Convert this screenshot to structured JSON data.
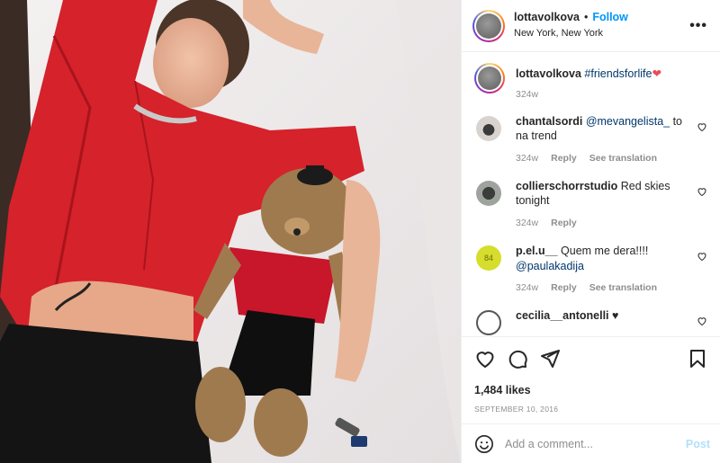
{
  "post": {
    "image_alt": "photo",
    "author": {
      "username": "lottavolkova",
      "separator": "•",
      "follow_label": "Follow",
      "location": "New York, New York",
      "more_icon": "more-horizontal-icon"
    },
    "caption": {
      "username": "lottavolkova",
      "hashtag": "#friendsforlife",
      "emoji": "❤",
      "time": "324w"
    },
    "comments": [
      {
        "username": "chantalsordi",
        "mention": "@mevangelista_",
        "text": " to na trend",
        "time": "324w",
        "reply": "Reply",
        "translate": "See translation",
        "avatar_color": "#d8d3cf"
      },
      {
        "username": "collierschorrstudio",
        "mention": "",
        "text": "Red skies tonight",
        "time": "324w",
        "reply": "Reply",
        "translate": "",
        "avatar_color": "#7a7f78"
      },
      {
        "username": "p.el.u__",
        "mention": "",
        "text": "Quem me dera!!!! ",
        "mention2": "@paulakadija",
        "time": "324w",
        "reply": "Reply",
        "translate": "See translation",
        "avatar_color": "#d6dd2c"
      },
      {
        "username": "cecilia__antonelli",
        "mention": "",
        "text": " ♥",
        "time": "",
        "reply": "",
        "translate": "",
        "avatar_color": "#ffffff"
      }
    ],
    "likes": "1,484 likes",
    "date": "SEPTEMBER 10, 2016",
    "add_comment": {
      "placeholder": "Add a comment...",
      "post_label": "Post"
    }
  },
  "colors": {
    "accent": "#0095f6",
    "post_disabled": "#b2dffc",
    "muted": "#8e8e8e",
    "like_red": "#ed4956"
  }
}
